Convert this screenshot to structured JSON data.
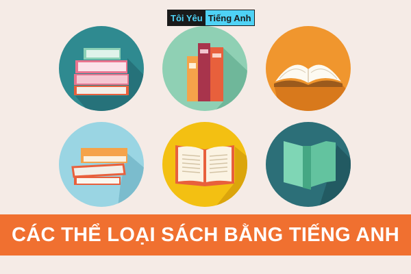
{
  "logo": {
    "part1": "Tôi Yêu",
    "part2": "Tiếng Anh"
  },
  "headline": "CÁC THỂ LOẠI SÁCH BẰNG TIẾNG ANH",
  "icons": [
    {
      "name": "stacked-books-icon",
      "color": "#2f8a90"
    },
    {
      "name": "upright-books-icon",
      "color": "#8fd0b4"
    },
    {
      "name": "open-book-icon",
      "color": "#f0962e"
    },
    {
      "name": "closed-books-stack-icon",
      "color": "#9ad5e3"
    },
    {
      "name": "open-book-with-text-icon",
      "color": "#f3c012"
    },
    {
      "name": "standing-book-icon",
      "color": "#2c6f78"
    }
  ],
  "colors": {
    "background": "#f5ebe6",
    "banner": "#f07030",
    "logo_cyan": "#4fd2f5"
  }
}
